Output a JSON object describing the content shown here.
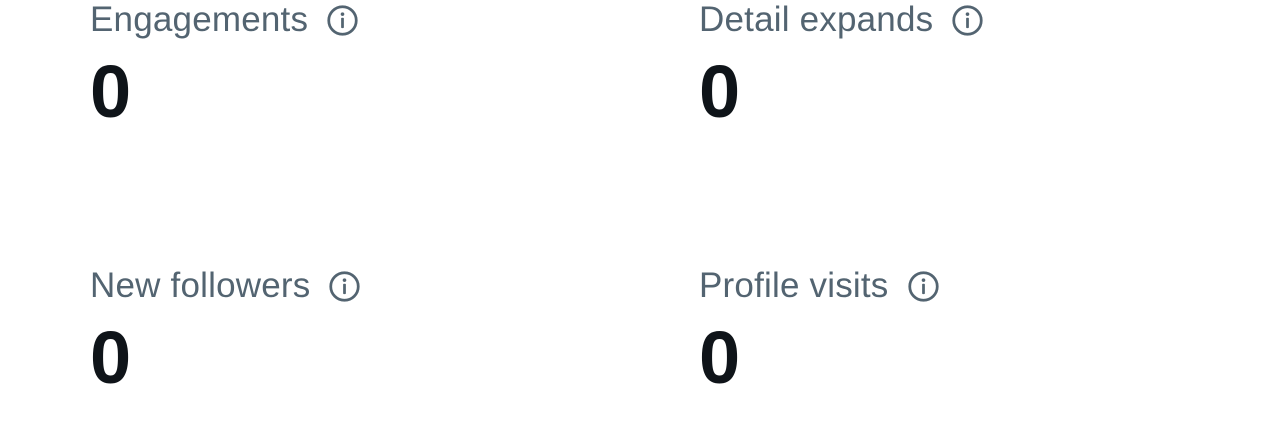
{
  "metrics": [
    {
      "label": "Engagements",
      "value": "0",
      "icon": "info-icon"
    },
    {
      "label": "Detail expands",
      "value": "0",
      "icon": "info-icon"
    },
    {
      "label": "New followers",
      "value": "0",
      "icon": "info-icon"
    },
    {
      "label": "Profile visits",
      "value": "0",
      "icon": "info-icon"
    }
  ],
  "colors": {
    "label": "#536471",
    "value": "#0f1419",
    "background": "#ffffff"
  }
}
